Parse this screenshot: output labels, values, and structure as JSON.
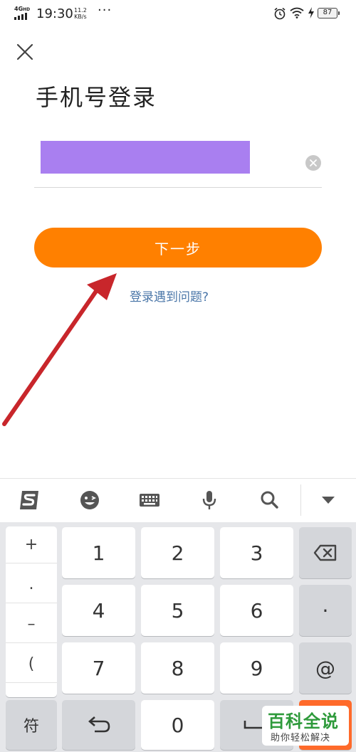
{
  "status_bar": {
    "network": "4G",
    "network_sup": "HD",
    "time": "19:30",
    "speed_value": "11.2",
    "speed_unit": "KB/s",
    "more": "···",
    "battery": "87"
  },
  "header": {
    "close_icon": "close-icon",
    "title": "手机号登录"
  },
  "phone_input": {
    "value": "",
    "clear_icon": "clear-icon"
  },
  "actions": {
    "next_label": "下一步",
    "help_label": "登录遇到问题?"
  },
  "keyboard": {
    "toolbar_icons": [
      "sogou-logo-icon",
      "emoji-icon",
      "keyboard-icon",
      "microphone-icon",
      "search-icon",
      "collapse-icon"
    ],
    "symbols": [
      "+",
      ".",
      "–",
      "(",
      "、"
    ],
    "digits": [
      "1",
      "2",
      "3",
      "4",
      "5",
      "6",
      "7",
      "8",
      "9",
      "0"
    ],
    "side_keys": [
      "·",
      "@"
    ],
    "symbol_key": "符"
  },
  "watermark": {
    "title": "百科全说",
    "subtitle": "助你轻松解决"
  },
  "colors": {
    "accent": "#ff8000",
    "link": "#4a76a8",
    "mask": "#a97ff0",
    "arrow": "#c8262b",
    "watermark_green": "#2e9a3b"
  }
}
